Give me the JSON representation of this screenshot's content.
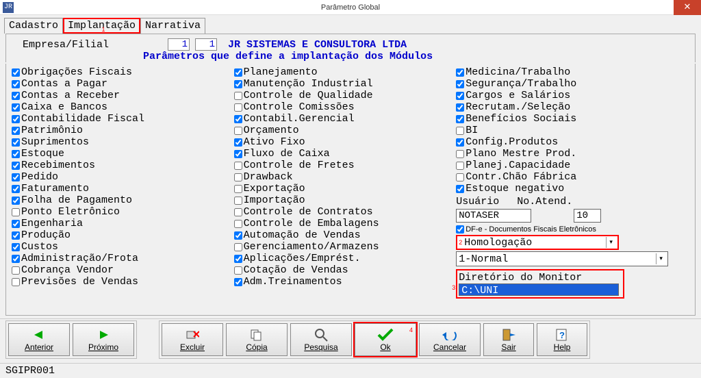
{
  "window": {
    "title": "Parâmetro Global",
    "icon_text": "JR"
  },
  "tabs": {
    "cadastro": "Cadastro",
    "implantacao": "Implantação",
    "narrativa": "Narrativa"
  },
  "header": {
    "label": "Empresa/Filial",
    "emp": "1",
    "fil": "1",
    "company": "JR SISTEMAS E CONSULTORA LTDA",
    "subtitle": "Parâmetros que define a implantação dos Módulos"
  },
  "col1": [
    {
      "c": true,
      "t": "Obrigações Fiscais"
    },
    {
      "c": true,
      "t": "Contas a Pagar"
    },
    {
      "c": true,
      "t": "Contas a Receber"
    },
    {
      "c": true,
      "t": "Caixa e Bancos"
    },
    {
      "c": true,
      "t": "Contabilidade Fiscal"
    },
    {
      "c": true,
      "t": "Patrimônio"
    },
    {
      "c": true,
      "t": "Suprimentos"
    },
    {
      "c": true,
      "t": "Estoque"
    },
    {
      "c": true,
      "t": "Recebimentos"
    },
    {
      "c": true,
      "t": "Pedido"
    },
    {
      "c": true,
      "t": "Faturamento"
    },
    {
      "c": true,
      "t": "Folha de Pagamento"
    },
    {
      "c": false,
      "t": "Ponto Eletrônico"
    },
    {
      "c": true,
      "t": "Engenharia"
    },
    {
      "c": true,
      "t": "Produção"
    },
    {
      "c": true,
      "t": "Custos"
    },
    {
      "c": true,
      "t": "Administração/Frota"
    },
    {
      "c": false,
      "t": "Cobrança Vendor"
    },
    {
      "c": false,
      "t": "Previsões de Vendas"
    }
  ],
  "col2": [
    {
      "c": true,
      "t": "Planejamento"
    },
    {
      "c": true,
      "t": "Manutenção Industrial"
    },
    {
      "c": false,
      "t": "Controle de Qualidade"
    },
    {
      "c": false,
      "t": "Controle Comissões"
    },
    {
      "c": true,
      "t": "Contabil.Gerencial"
    },
    {
      "c": false,
      "t": "Orçamento"
    },
    {
      "c": true,
      "t": "Ativo Fixo"
    },
    {
      "c": true,
      "t": "Fluxo de Caixa"
    },
    {
      "c": false,
      "t": "Controle de Fretes"
    },
    {
      "c": false,
      "t": "Drawback"
    },
    {
      "c": false,
      "t": "Exportação"
    },
    {
      "c": false,
      "t": "Importação"
    },
    {
      "c": false,
      "t": "Controle de Contratos"
    },
    {
      "c": false,
      "t": "Controle de Embalagens"
    },
    {
      "c": true,
      "t": "Automação de Vendas"
    },
    {
      "c": false,
      "t": "Gerenciamento/Armazens"
    },
    {
      "c": true,
      "t": "Aplicações/Emprést."
    },
    {
      "c": false,
      "t": "Cotação de Vendas"
    },
    {
      "c": true,
      "t": "Adm.Treinamentos"
    }
  ],
  "col3": [
    {
      "c": true,
      "t": "Medicina/Trabalho"
    },
    {
      "c": true,
      "t": "Segurança/Trabalho"
    },
    {
      "c": true,
      "t": "Cargos e Salários"
    },
    {
      "c": true,
      "t": "Recrutam./Seleção"
    },
    {
      "c": true,
      "t": "Benefícios Sociais"
    },
    {
      "c": false,
      "t": "BI"
    },
    {
      "c": true,
      "t": "Config.Produtos"
    },
    {
      "c": false,
      "t": "Plano Mestre Prod."
    },
    {
      "c": false,
      "t": "Planej.Capacidade"
    },
    {
      "c": false,
      "t": "Contr.Chão Fábrica"
    },
    {
      "c": true,
      "t": "Estoque negativo"
    }
  ],
  "right": {
    "usuario_lbl": "Usuário",
    "no_atend_lbl": "No.Atend.",
    "usuario": "NOTASER",
    "no_atend": "10",
    "dfe_lbl": "DF-e - Documentos Fiscais Eletrônicos",
    "dfe_checked": true,
    "combo1": "Homologação",
    "combo2": "1-Normal",
    "dir_lbl": "Diretório do Monitor",
    "dir_val": "C:\\UNI"
  },
  "buttons": {
    "anterior": "Anterior",
    "proximo": "Próximo",
    "excluir": "Excluir",
    "copia": "Cópia",
    "pesquisa": "Pesquisa",
    "ok": "Ok",
    "cancelar": "Cancelar",
    "sair": "Sair",
    "help": "Help"
  },
  "status": "SGIPR001",
  "annot": {
    "a1": "1",
    "a2": "2",
    "a3": "3",
    "a4": "4"
  }
}
